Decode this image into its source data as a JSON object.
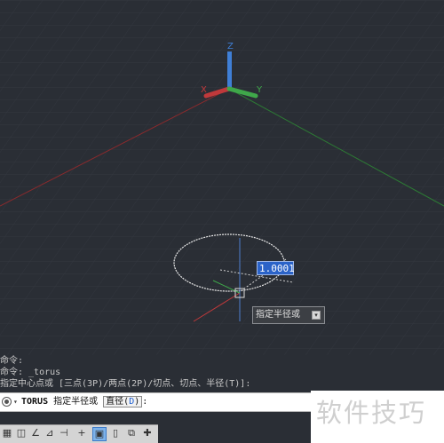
{
  "viewport": {
    "axis_labels": {
      "x": "X",
      "y": "Y",
      "z": "Z"
    },
    "dynamic_input": {
      "value": "1.0001"
    },
    "tooltip": {
      "label": "指定半径或"
    }
  },
  "command_history": [
    "命令:",
    "命令: _torus",
    "指定中心点或 [三点(3P)/两点(2P)/切点、切点、半径(T)]:"
  ],
  "command_line": {
    "command": "TORUS",
    "prompt": "指定半径或",
    "option_label": "直径(",
    "option_key": "D",
    "option_close": ")",
    "suffix": ":"
  },
  "watermark": {
    "text": "软件技巧"
  },
  "colors": {
    "background": "#2a2e35",
    "x_axis": "#c0393b",
    "y_axis": "#3fa84a",
    "z_axis": "#3f7fd6",
    "input_highlight": "#2b63c8"
  },
  "status_bar": {
    "icons": [
      "grid-icon",
      "snap-mode-icon",
      "infer-constraints-icon",
      "dynamic-ucs-icon",
      "ortho-icon",
      "polar-icon",
      "object-snap-icon",
      "lineweight-icon",
      "transparency-icon",
      "selection-cycling-icon",
      "3d-osnap-icon"
    ]
  }
}
